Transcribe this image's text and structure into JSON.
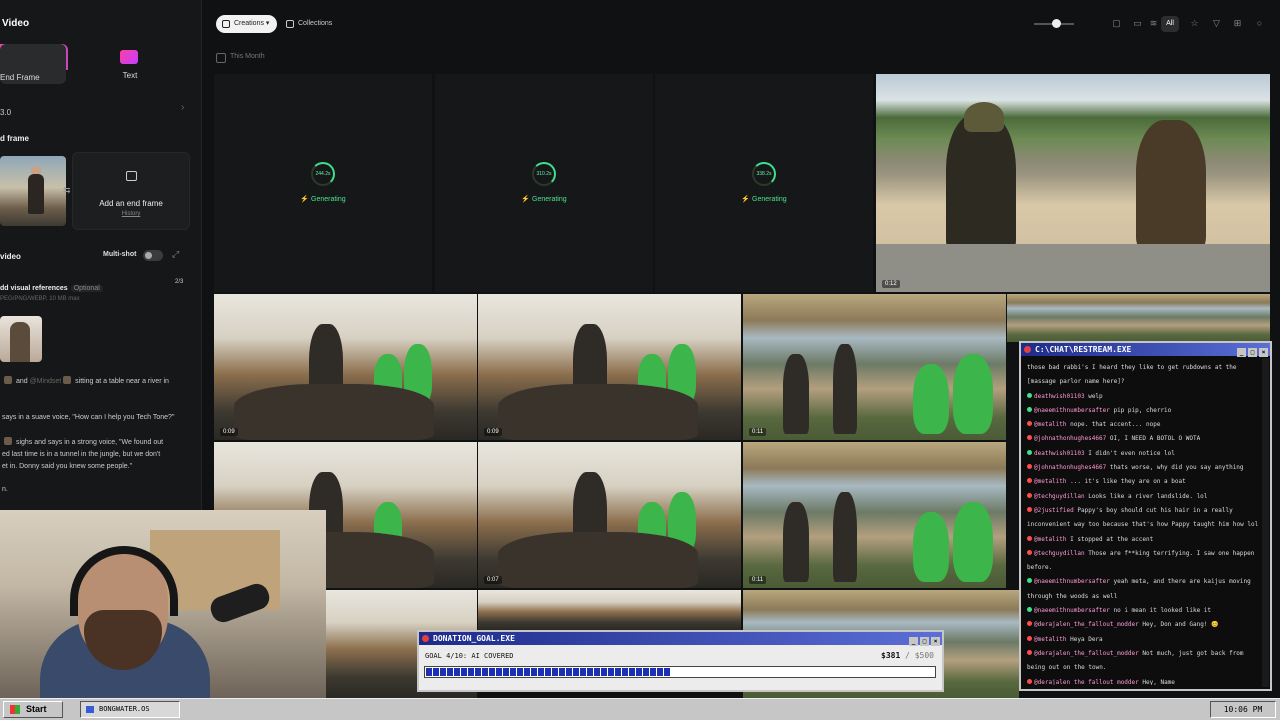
{
  "left_panel": {
    "title": "Video",
    "modes": [
      {
        "label": "End Frame",
        "icon": "frames-icon"
      },
      {
        "label": "Text",
        "icon": "text-mode-icon"
      }
    ],
    "model_row": "3.0",
    "end_frame_section": "d frame",
    "add_end_frame": "Add an end frame",
    "history": "History",
    "video_section": "video",
    "multishot": "Multi-shot",
    "refs_label": "dd visual references",
    "refs_optional": "Optional",
    "refs_sub": "PEG/PNG/WEBP, 10 MB max",
    "refs_count": "2/3",
    "prompt_lines": [
      {
        "before": " and ",
        "mention": "@Mindset",
        "after": " sitting at a table near a river in"
      },
      {
        "text": "says in a suave voice, \"How can I help you Tech Tone?\""
      },
      {
        "before": " sighs and says in a strong voice, \"We found out"
      },
      {
        "text": "ed last time is in a tunnel in the jungle, but we don't"
      },
      {
        "text": "et in. Donny said you knew some people.\""
      },
      {
        "text": "n."
      }
    ]
  },
  "topbar": {
    "creations": "Creations",
    "collections": "Collections",
    "filter_all": "All",
    "this_month": "This Month"
  },
  "generating": [
    {
      "timer": "244.2s",
      "label": "Generating"
    },
    {
      "timer": "310.2s",
      "label": "Generating"
    },
    {
      "timer": "338.2s",
      "label": "Generating"
    }
  ],
  "tiles": {
    "main_river_duration": "0:12",
    "row1": [
      "0:09",
      "0:09",
      "0:11"
    ],
    "row2": [
      "",
      "0:07",
      "0:11"
    ]
  },
  "chat": {
    "title": "C:\\CHAT\\RESTREAM.EXE",
    "messages": [
      {
        "user": "",
        "text": "those bad rabbi's I heard they like to get rubdowns at the",
        "color": ""
      },
      {
        "user": "",
        "text": "[massage parlor name here]?",
        "color": ""
      },
      {
        "user": "deathwish01103",
        "text": "welp",
        "color": "#3ee08a"
      },
      {
        "user": "@naeemithnumbersafter",
        "text": "pip pip, cherrio",
        "color": "#3ee08a"
      },
      {
        "user": "@metalith",
        "text": "nope. that accent... nope",
        "color": "#ff4d4d"
      },
      {
        "user": "@johnathonhughes4667",
        "text": "OI, I NEED A BOTOL O WOTA",
        "color": "#ff4d4d"
      },
      {
        "user": "deathwish01103",
        "text": "I didn't even notice lol",
        "color": "#3ee08a"
      },
      {
        "user": "@johnathonhughes4667",
        "text": "thats worse, why did you say anything",
        "color": "#ff4d4d"
      },
      {
        "user": "@metalith",
        "text": "... it's like they are on a boat",
        "color": "#ff4d4d"
      },
      {
        "user": "@techguydillan",
        "text": "Looks like a river landslide. lol",
        "color": "#ff4d4d"
      },
      {
        "user": "@2justified",
        "text": "Pappy's boy should cut his hair in a really",
        "color": "#ff4d4d"
      },
      {
        "user": "",
        "text": "inconvenient way too because that's how Pappy taught him how lol",
        "color": ""
      },
      {
        "user": "@metalith",
        "text": "I stopped at the accent",
        "color": "#ff4d4d"
      },
      {
        "user": "@techguydillan",
        "text": "Those are f**king terrifying. I saw one happen",
        "color": "#ff4d4d"
      },
      {
        "user": "",
        "text": "before.",
        "color": ""
      },
      {
        "user": "@naeemithnumbersafter",
        "text": "yeah meta, and there are kaijus moving",
        "color": "#3ee08a"
      },
      {
        "user": "",
        "text": "through the woods as well",
        "color": ""
      },
      {
        "user": "@naeemithnumbersafter",
        "text": "no i mean it looked like it",
        "color": "#3ee08a"
      },
      {
        "user": "@derajalen_the_fallout_modder",
        "text": "Hey, Don and Gang! 😊",
        "color": "#ff4d4d"
      },
      {
        "user": "@metalith",
        "text": "Heya Dera",
        "color": "#ff4d4d"
      },
      {
        "user": "@derajalen_the_fallout_modder",
        "text": "Not much, just got back from",
        "color": "#ff4d4d"
      },
      {
        "user": "",
        "text": "being out on the town.",
        "color": ""
      },
      {
        "user": "@derajalen_the_fallout_modder",
        "text": "Hey, Name",
        "color": "#ff4d4d"
      }
    ]
  },
  "donation": {
    "title": "DONATION_GOAL.EXE",
    "goal_text": "GOAL 4/10: AI COVERED",
    "current": "$381",
    "total": "/ $500",
    "progress": 0.48
  },
  "taskbar": {
    "start": "Start",
    "task": "BONGWATER.OS",
    "clock": "10:06 PM"
  }
}
